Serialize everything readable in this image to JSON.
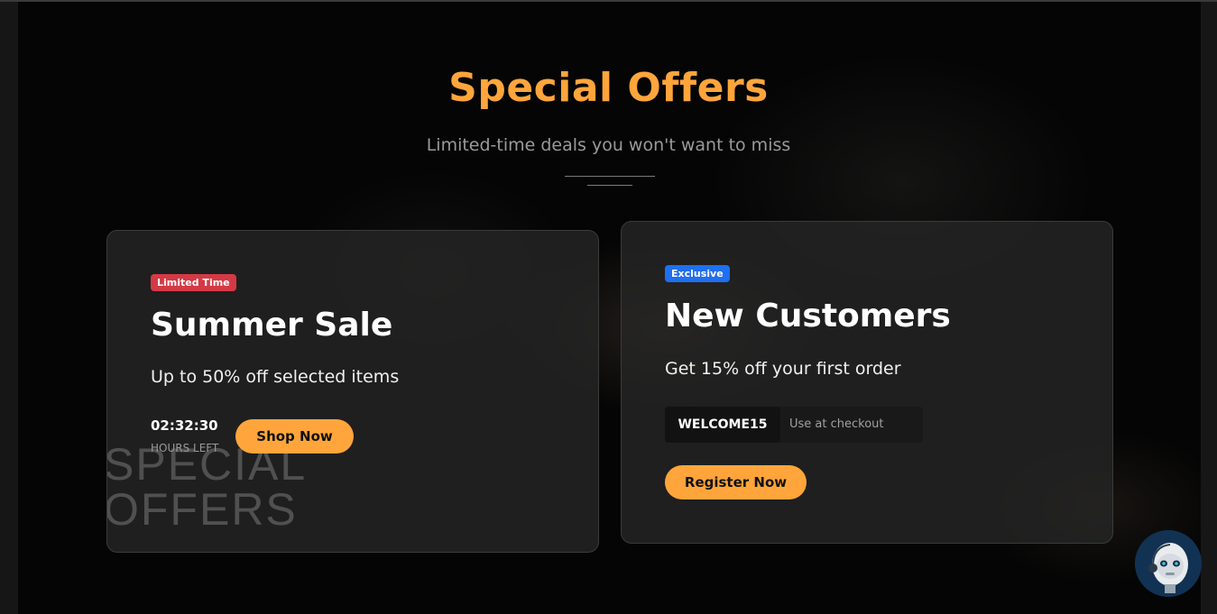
{
  "section": {
    "title": "Special Offers",
    "subtitle": "Limited-time deals you won't want to miss"
  },
  "offers": [
    {
      "badge": "Limited Time",
      "title": "Summer Sale",
      "description": "Up to 50% off selected items",
      "timer": "02:32:30",
      "timer_label": "HOURS LEFT",
      "button": "Shop Now",
      "watermark_line1": "SPECIAL",
      "watermark_line2": "OFFERS"
    },
    {
      "badge": "Exclusive",
      "title": "New Customers",
      "description": "Get 15% off your first order",
      "promo_code": "WELCOME15",
      "promo_hint": "Use at checkout",
      "button": "Register Now"
    }
  ],
  "colors": {
    "accent": "#ffa53b",
    "badge_red": "#d43a45",
    "badge_blue": "#1f6ff0",
    "background": "#050505"
  },
  "icons": {
    "chatbot": "robot-assistant-icon"
  }
}
